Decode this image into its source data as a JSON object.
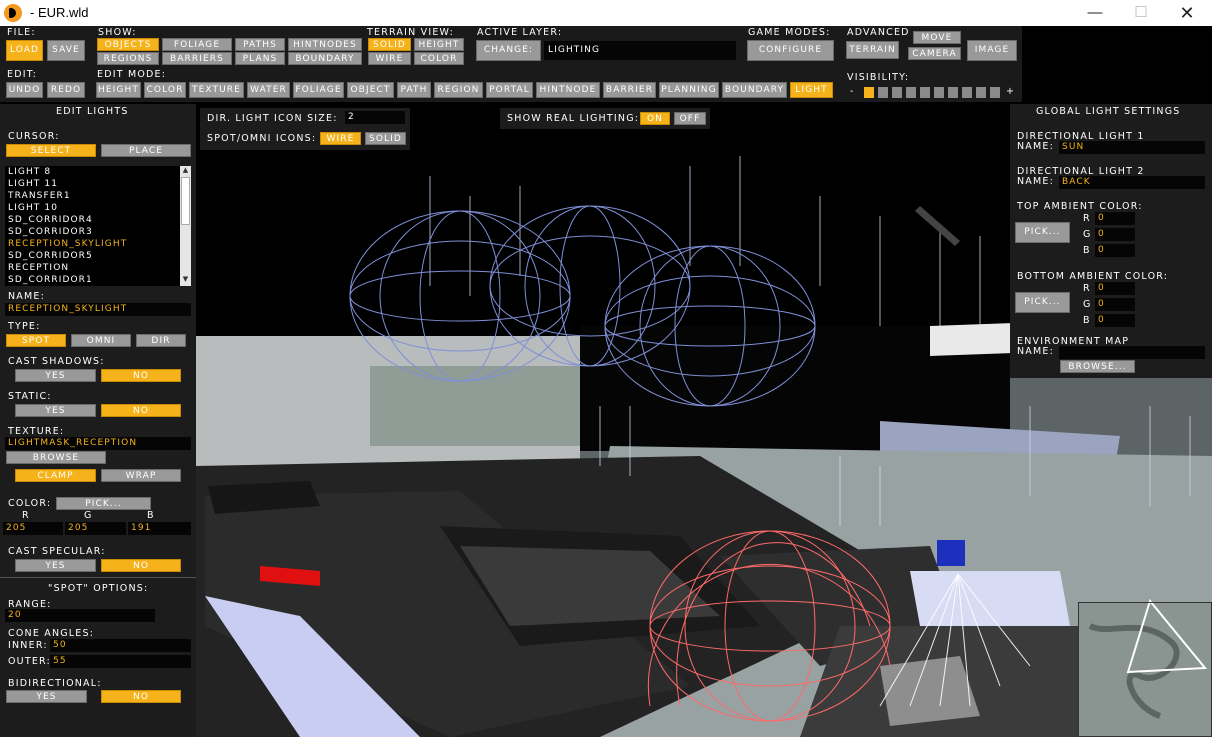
{
  "window": {
    "title": "- EUR.wld"
  },
  "toolbar": {
    "file_label": "File:",
    "load": "Load",
    "save": "Save",
    "show_label": "Show:",
    "show": [
      "Objects",
      "Foliage",
      "Paths",
      "HintNodes",
      "Regions",
      "Barriers",
      "Plans",
      "Boundary"
    ],
    "terrain_view_label": "Terrain View:",
    "terrain_view": [
      "Solid",
      "Height",
      "Wire",
      "Color"
    ],
    "active_layer_label": "Active Layer:",
    "change_label": "Change:",
    "active_layer_value": "Lighting",
    "game_modes_label": "Game Modes:",
    "configure": "Configure",
    "advanced_label": "Advanced",
    "move": "Move",
    "terrain": "Terrain",
    "camera": "Camera",
    "image": "Image",
    "edit_label": "Edit:",
    "undo": "Undo",
    "redo": "Redo",
    "edit_mode_label": "Edit Mode:",
    "edit_modes": [
      "Height",
      "Color",
      "Texture",
      "Water",
      "Foliage",
      "Object",
      "Path",
      "Region",
      "Portal",
      "HintNode",
      "Barrier",
      "Planning",
      "Boundary",
      "Light"
    ],
    "visibility_label": "Visibility:",
    "vis_minus": "-",
    "vis_plus": "+"
  },
  "left_panel": {
    "header": "Edit Lights",
    "cursor_label": "Cursor:",
    "select": "Select",
    "place": "Place",
    "lights": [
      "Light 8",
      "Light 11",
      "transfer1",
      "Light 10",
      "SD_corridor4",
      "SD_corridor3",
      "RECEPTION_SKYLIGHT",
      "SD_corridor5",
      "RECEPTION",
      "SD_corridor1"
    ],
    "selected_light": "RECEPTION_SKYLIGHT",
    "name_label": "Name:",
    "name_value": "RECEPTION_SKYLIGHT",
    "type_label": "Type:",
    "type_spot": "Spot",
    "type_omni": "Omni",
    "type_dir": "Dir",
    "cast_shadows_label": "Cast Shadows:",
    "static_label": "Static:",
    "yes": "Yes",
    "no": "No",
    "texture_label": "Texture:",
    "texture_value": "LIGHTMASK_RECEPTION",
    "browse": "Browse",
    "clamp": "Clamp",
    "wrap": "Wrap",
    "color_label": "Color:",
    "pick": "Pick...",
    "r": "R",
    "g": "G",
    "b": "B",
    "color_r": "205",
    "color_g": "205",
    "color_b": "191",
    "cast_specular_label": "Cast Specular:",
    "spot_options": "\"Spot\" Options:",
    "range_label": "Range:",
    "range_value": "20",
    "cone_angles_label": "Cone Angles:",
    "inner_label": "Inner:",
    "inner_value": "50",
    "outer_label": "Outer:",
    "outer_value": "55",
    "bidirectional_label": "Bidirectional:"
  },
  "icon_panel": {
    "size_label": "Dir. Light Icon Size:",
    "size_value": "2",
    "icons_label": "Spot/Omni Icons:",
    "wire": "Wire",
    "solid": "Solid"
  },
  "real_lighting": {
    "label": "Show Real Lighting:",
    "on": "On",
    "off": "Off"
  },
  "global_panel": {
    "header": "Global Light Settings",
    "dir1_label": "Directional Light 1",
    "name_label": "Name:",
    "dir1_name": "SUN",
    "dir2_label": "Directional Light 2",
    "dir2_name": "BACK",
    "top_ambient_label": "Top Ambient Color:",
    "pick": "Pick...",
    "r": "R",
    "g": "G",
    "b": "B",
    "top_r": "0",
    "top_g": "0",
    "top_b": "0",
    "bottom_ambient_label": "Bottom Ambient Color:",
    "bot_r": "0",
    "bot_g": "0",
    "bot_b": "0",
    "env_map_label": "Environment Map",
    "env_name": "",
    "browse": "Browse..."
  },
  "colors": {
    "accent": "#f5b21b",
    "button": "#999999",
    "panel": "#1c1c1c",
    "field": "#050505",
    "wire_blue": "#7f8fd6",
    "wire_red": "#ff6a6a"
  }
}
